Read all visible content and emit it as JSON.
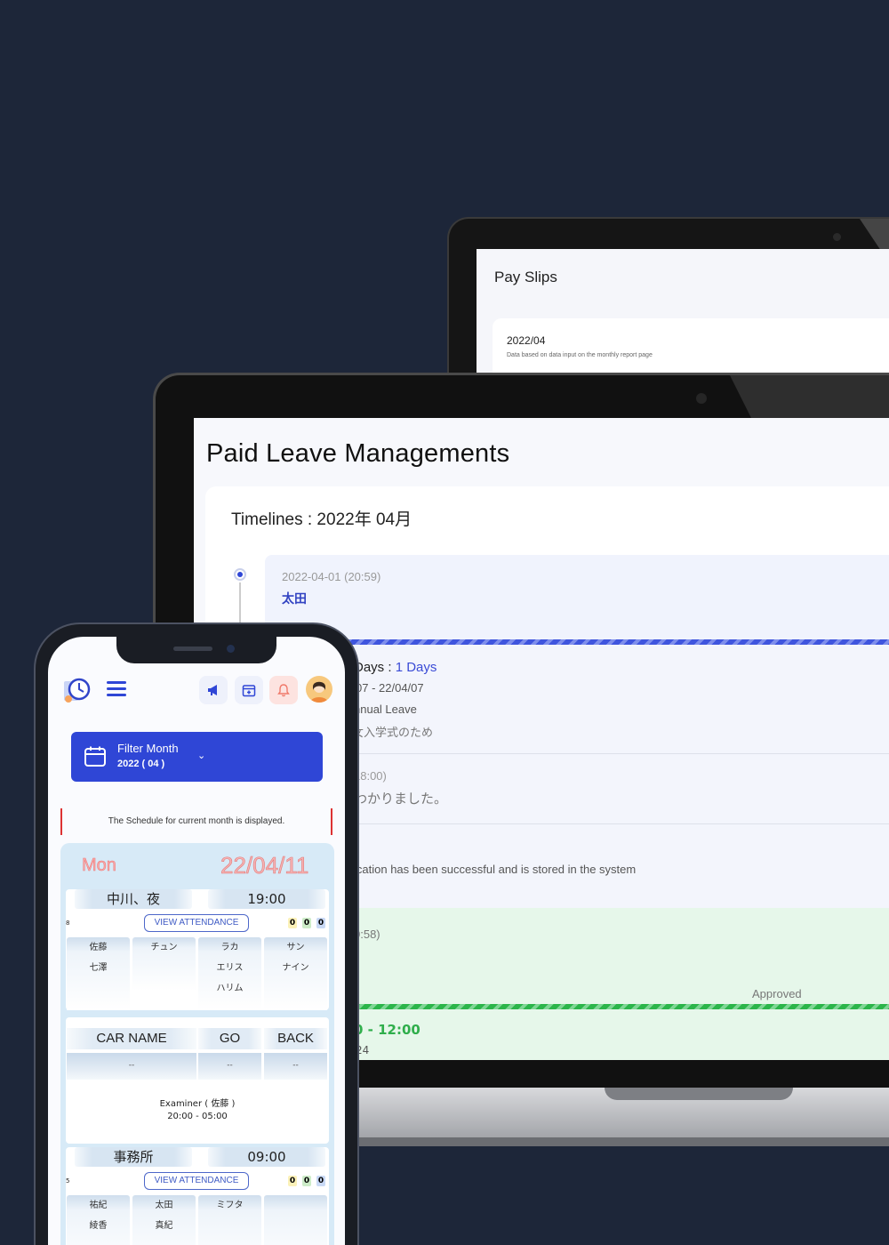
{
  "payslips": {
    "title": "Pay Slips",
    "card_month": "2022/04",
    "card_desc": "Data based on data input on the monthly report page"
  },
  "paid_leave": {
    "page_title": "Paid Leave Managements",
    "timeline_title": "Timelines : 2022年 04月",
    "entry1": {
      "time": "2022-04-01 (20:59)",
      "name": "太田"
    },
    "request": {
      "days_label": "Days : ",
      "days_value": "1 Days",
      "range": "07 - 22/04/07",
      "type": "nnual Leave",
      "reason": "女入学式のため"
    },
    "entry2": {
      "time": "18:00)",
      "message": "わかりました。"
    },
    "entry3": {
      "message": "ication has been successful and is stored in the system"
    },
    "entry4": {
      "time": "0:58)",
      "status": "Approved",
      "hours": "0 - 12:00",
      "extra": "24"
    }
  },
  "phone": {
    "filter": {
      "label": "Filter Month",
      "value": "2022 ( 04 )"
    },
    "notice": "The Schedule for current month is displayed.",
    "schedule": {
      "day": "Mon",
      "date": "22/04/11",
      "block1": {
        "location": "中川、夜",
        "time": "19:00",
        "number": "8",
        "attendance_label": "VIEW ATTENDANCE",
        "counts": [
          "0",
          "0",
          "0"
        ],
        "columns": [
          [
            "佐藤",
            "七澤"
          ],
          [
            "チュン"
          ],
          [
            "ラカ",
            "エリス",
            "ハリム"
          ],
          [
            "サン",
            "ナイン"
          ]
        ]
      },
      "car": {
        "headers": [
          "CAR NAME",
          "GO",
          "BACK"
        ],
        "values": [
          "--",
          "--",
          "--"
        ],
        "examiner": "Examiner ( 佐藤 )",
        "hours": "20:00 - 05:00"
      },
      "block2": {
        "location": "事務所",
        "time": "09:00",
        "number": "5",
        "attendance_label": "VIEW ATTENDANCE",
        "counts": [
          "0",
          "0",
          "0"
        ],
        "columns": [
          [
            "祐紀",
            "綾香"
          ],
          [
            "太田",
            "真紀"
          ],
          [
            "ミフタ"
          ],
          []
        ]
      }
    }
  },
  "colors": {
    "background": "#1d2639",
    "primary": "#2f46d6",
    "approved": "#2fae4b",
    "date_pink": "#f6b4b4"
  }
}
